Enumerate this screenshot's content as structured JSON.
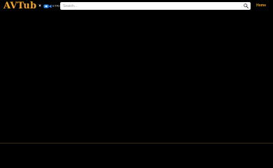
{
  "header": {
    "logo_text": "AVTub",
    "logo_separator": "×",
    "partner_text": "STRIPCHAT",
    "partner_icon": "camera-logo-icon"
  },
  "search": {
    "placeholder": "Search...",
    "value": "",
    "icon": "search-icon"
  },
  "nav": {
    "home_label": "Home"
  },
  "colors": {
    "background": "#000000",
    "brand": "#f2a62a",
    "search_background": "#ffffff",
    "partner_accent": "#2a8cff",
    "divider": "#3a2a10"
  }
}
